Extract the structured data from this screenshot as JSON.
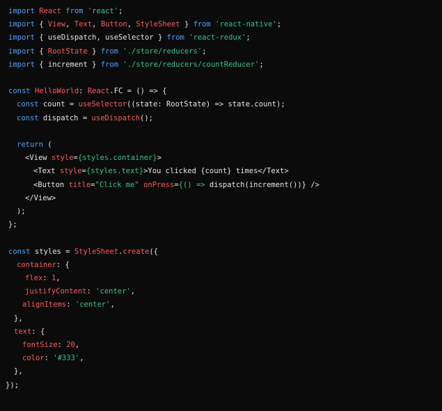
{
  "code_lines": [
    {
      "indent": 12,
      "tokens": [
        {
          "t": "import",
          "c": "kw"
        },
        {
          "t": " ",
          "c": "pn"
        },
        {
          "t": "React",
          "c": "id"
        },
        {
          "t": " ",
          "c": "pn"
        },
        {
          "t": "from",
          "c": "kw"
        },
        {
          "t": " ",
          "c": "pn"
        },
        {
          "t": "'react'",
          "c": "str"
        },
        {
          "t": ";",
          "c": "pn"
        }
      ]
    },
    {
      "indent": 12,
      "tokens": [
        {
          "t": "import",
          "c": "kw"
        },
        {
          "t": " { ",
          "c": "pn"
        },
        {
          "t": "View",
          "c": "id"
        },
        {
          "t": ", ",
          "c": "pn"
        },
        {
          "t": "Text",
          "c": "id"
        },
        {
          "t": ", ",
          "c": "pn"
        },
        {
          "t": "Button",
          "c": "id"
        },
        {
          "t": ", ",
          "c": "pn"
        },
        {
          "t": "StyleSheet",
          "c": "id"
        },
        {
          "t": " } ",
          "c": "pn"
        },
        {
          "t": "from",
          "c": "kw"
        },
        {
          "t": " ",
          "c": "pn"
        },
        {
          "t": "'react-native'",
          "c": "str"
        },
        {
          "t": ";",
          "c": "pn"
        }
      ]
    },
    {
      "indent": 12,
      "tokens": [
        {
          "t": "import",
          "c": "kw"
        },
        {
          "t": " { useDispatch, useSelector } ",
          "c": "pn"
        },
        {
          "t": "from",
          "c": "kw"
        },
        {
          "t": " ",
          "c": "pn"
        },
        {
          "t": "'react-redux'",
          "c": "str"
        },
        {
          "t": ";",
          "c": "pn"
        }
      ]
    },
    {
      "indent": 12,
      "tokens": [
        {
          "t": "import",
          "c": "kw"
        },
        {
          "t": " { ",
          "c": "pn"
        },
        {
          "t": "RootState",
          "c": "id"
        },
        {
          "t": " } ",
          "c": "pn"
        },
        {
          "t": "from",
          "c": "kw"
        },
        {
          "t": " ",
          "c": "pn"
        },
        {
          "t": "'./store/reducers'",
          "c": "str"
        },
        {
          "t": ";",
          "c": "pn"
        }
      ]
    },
    {
      "indent": 12,
      "tokens": [
        {
          "t": "import",
          "c": "kw"
        },
        {
          "t": " { increment } ",
          "c": "pn"
        },
        {
          "t": "from",
          "c": "kw"
        },
        {
          "t": " ",
          "c": "pn"
        },
        {
          "t": "'./store/reducers/countReducer'",
          "c": "str"
        },
        {
          "t": ";",
          "c": "pn"
        }
      ]
    },
    {
      "indent": 12,
      "tokens": []
    },
    {
      "indent": 12,
      "tokens": [
        {
          "t": "const",
          "c": "kw"
        },
        {
          "t": " ",
          "c": "pn"
        },
        {
          "t": "HelloWorld",
          "c": "id"
        },
        {
          "t": ": ",
          "c": "pn"
        },
        {
          "t": "React",
          "c": "id"
        },
        {
          "t": ".FC = () => {",
          "c": "pn"
        }
      ]
    },
    {
      "indent": 24,
      "tokens": [
        {
          "t": "const",
          "c": "kw"
        },
        {
          "t": " count = ",
          "c": "pn"
        },
        {
          "t": "useSelector",
          "c": "id"
        },
        {
          "t": "((state: RootState) => state.count);",
          "c": "pn"
        }
      ]
    },
    {
      "indent": 24,
      "tokens": [
        {
          "t": "const",
          "c": "kw"
        },
        {
          "t": " dispatch = ",
          "c": "pn"
        },
        {
          "t": "useDispatch",
          "c": "id"
        },
        {
          "t": "();",
          "c": "pn"
        }
      ]
    },
    {
      "indent": 24,
      "tokens": []
    },
    {
      "indent": 24,
      "tokens": [
        {
          "t": "return",
          "c": "kw"
        },
        {
          "t": " (",
          "c": "pn"
        }
      ]
    },
    {
      "indent": 36,
      "tokens": [
        {
          "t": "<View ",
          "c": "pn"
        },
        {
          "t": "style",
          "c": "id"
        },
        {
          "t": "=",
          "c": "pn"
        },
        {
          "t": "{styles.container}",
          "c": "str"
        },
        {
          "t": ">",
          "c": "pn"
        }
      ]
    },
    {
      "indent": 48,
      "tokens": [
        {
          "t": "<Text ",
          "c": "pn"
        },
        {
          "t": "style",
          "c": "id"
        },
        {
          "t": "=",
          "c": "pn"
        },
        {
          "t": "{styles.text}",
          "c": "str"
        },
        {
          "t": ">You clicked {count} times</Text>",
          "c": "pn"
        }
      ]
    },
    {
      "indent": 48,
      "tokens": [
        {
          "t": "<Button ",
          "c": "pn"
        },
        {
          "t": "title",
          "c": "id"
        },
        {
          "t": "=",
          "c": "pn"
        },
        {
          "t": "\"Click me\"",
          "c": "str"
        },
        {
          "t": " ",
          "c": "pn"
        },
        {
          "t": "onPress",
          "c": "id"
        },
        {
          "t": "=",
          "c": "pn"
        },
        {
          "t": "{() => ",
          "c": "str"
        },
        {
          "t": "dispatch(increment())} />",
          "c": "pn"
        }
      ]
    },
    {
      "indent": 36,
      "tokens": [
        {
          "t": "</View>",
          "c": "pn"
        }
      ]
    },
    {
      "indent": 24,
      "tokens": [
        {
          "t": ");",
          "c": "pn"
        }
      ]
    },
    {
      "indent": 12,
      "tokens": [
        {
          "t": "};",
          "c": "pn"
        }
      ]
    },
    {
      "indent": 12,
      "tokens": []
    },
    {
      "indent": 12,
      "tokens": [
        {
          "t": "const",
          "c": "kw"
        },
        {
          "t": " styles = ",
          "c": "pn"
        },
        {
          "t": "StyleSheet",
          "c": "id"
        },
        {
          "t": ".",
          "c": "pn"
        },
        {
          "t": "create",
          "c": "id"
        },
        {
          "t": "({",
          "c": "pn"
        }
      ]
    },
    {
      "indent": 24,
      "tokens": [
        {
          "t": "container",
          "c": "id"
        },
        {
          "t": ": {",
          "c": "pn"
        }
      ]
    },
    {
      "indent": 36,
      "tokens": [
        {
          "t": "flex",
          "c": "id"
        },
        {
          "t": ": ",
          "c": "pn"
        },
        {
          "t": "1",
          "c": "id"
        },
        {
          "t": ",",
          "c": "pn"
        }
      ]
    },
    {
      "indent": 36,
      "tokens": [
        {
          "t": "justifyContent",
          "c": "id"
        },
        {
          "t": ": ",
          "c": "pn"
        },
        {
          "t": "'center'",
          "c": "str"
        },
        {
          "t": ",",
          "c": "pn"
        }
      ]
    },
    {
      "indent": 32,
      "tokens": [
        {
          "t": "alignItems",
          "c": "id"
        },
        {
          "t": ": ",
          "c": "pn"
        },
        {
          "t": "'center'",
          "c": "str"
        },
        {
          "t": ",",
          "c": "pn"
        }
      ]
    },
    {
      "indent": 20,
      "tokens": [
        {
          "t": "},",
          "c": "pn"
        }
      ]
    },
    {
      "indent": 20,
      "tokens": [
        {
          "t": "text",
          "c": "id"
        },
        {
          "t": ": {",
          "c": "pn"
        }
      ]
    },
    {
      "indent": 32,
      "tokens": [
        {
          "t": "fontSize",
          "c": "id"
        },
        {
          "t": ": ",
          "c": "pn"
        },
        {
          "t": "20",
          "c": "id"
        },
        {
          "t": ",",
          "c": "pn"
        }
      ]
    },
    {
      "indent": 32,
      "tokens": [
        {
          "t": "color",
          "c": "id"
        },
        {
          "t": ": ",
          "c": "pn"
        },
        {
          "t": "'#333'",
          "c": "str"
        },
        {
          "t": ",",
          "c": "pn"
        }
      ]
    },
    {
      "indent": 20,
      "tokens": [
        {
          "t": "},",
          "c": "pn"
        }
      ]
    },
    {
      "indent": 8,
      "tokens": [
        {
          "t": "});",
          "c": "pn"
        }
      ]
    }
  ],
  "colors": {
    "background": "#0b0b0b",
    "keyword": "#4fa3ff",
    "identifier": "#ff5a5a",
    "string": "#35c58a",
    "plain": "#e6e6e6"
  }
}
